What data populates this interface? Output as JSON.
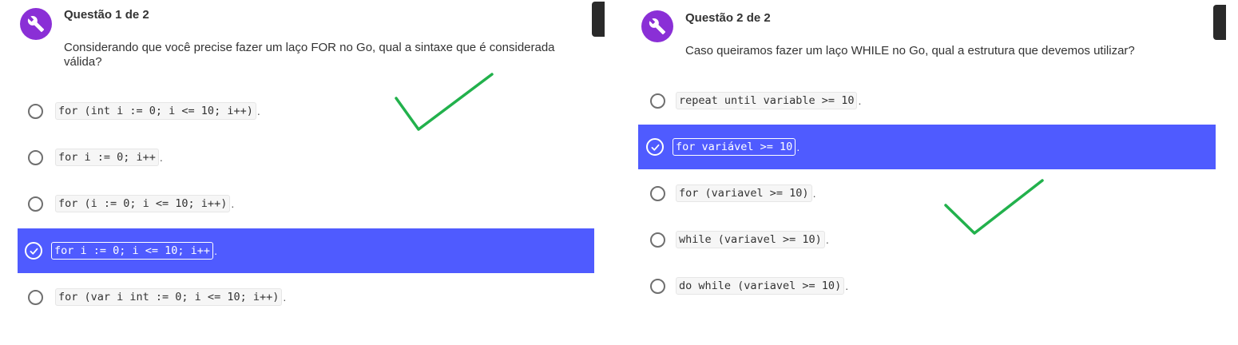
{
  "colors": {
    "accent_purple": "#8a2fd6",
    "selected_bg": "#4f5bff",
    "check_green": "#22b14c",
    "side_tab": "#2a2a2a"
  },
  "icons": {
    "question_icon": "wrench-icon",
    "selected_radio": "check-circle-icon",
    "annotation": "green-checkmark-icon"
  },
  "questions": [
    {
      "header": "Questão 1 de 2",
      "text": "Considerando que você precise fazer um laço FOR no Go, qual a sintaxe que é considerada válida?",
      "options": [
        {
          "code": "for (int i := 0; i <= 10; i++)",
          "suffix": ".",
          "selected": false
        },
        {
          "code": "for i := 0; i++",
          "suffix": ".",
          "selected": false
        },
        {
          "code": "for (i := 0; i <= 10; i++)",
          "suffix": ".",
          "selected": false
        },
        {
          "code": "for i := 0; i <= 10; i++",
          "suffix": ".",
          "selected": true
        },
        {
          "code": "for (var i int := 0; i <= 10; i++)",
          "suffix": ".",
          "selected": false
        }
      ]
    },
    {
      "header": "Questão 2 de 2",
      "text": "Caso queiramos fazer um laço WHILE no Go, qual a estrutura que devemos utilizar?",
      "options": [
        {
          "code": "repeat until variable >= 10",
          "suffix": ".",
          "selected": false
        },
        {
          "code": "for variável >= 10",
          "suffix": ".",
          "selected": true
        },
        {
          "code": "for (variavel >= 10)",
          "suffix": ".",
          "selected": false
        },
        {
          "code": "while (variavel >= 10)",
          "suffix": ".",
          "selected": false
        },
        {
          "code": "do while (variavel >= 10)",
          "suffix": ".",
          "selected": false
        }
      ]
    }
  ]
}
